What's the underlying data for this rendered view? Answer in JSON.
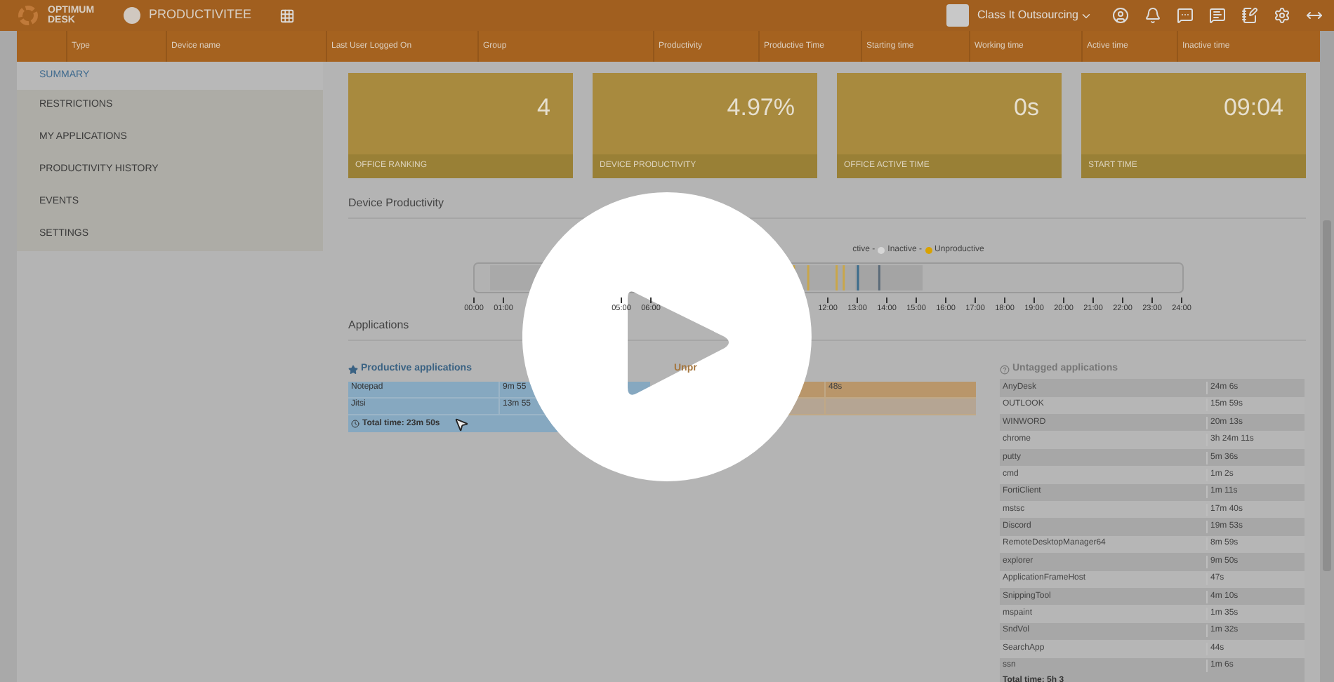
{
  "topbar": {
    "brand": "OPTIMUM DESK",
    "product": "PRODUCTIVITEE",
    "company": "Class It Outsourcing"
  },
  "columns": [
    "Type",
    "Device name",
    "Last User Logged On",
    "Group",
    "Productivity",
    "Productive Time",
    "Starting time",
    "Working time",
    "Active time",
    "Inactive time"
  ],
  "sidebar": {
    "items": [
      {
        "label": "SUMMARY",
        "selected": true
      },
      {
        "label": "RESTRICTIONS",
        "selected": false
      },
      {
        "label": "MY APPLICATIONS",
        "selected": false
      },
      {
        "label": "PRODUCTIVITY HISTORY",
        "selected": false
      },
      {
        "label": "EVENTS",
        "selected": false
      },
      {
        "label": "SETTINGS",
        "selected": false
      }
    ]
  },
  "cards": [
    {
      "value": "4",
      "label": "OFFICE RANKING"
    },
    {
      "value": "4.97%",
      "label": "DEVICE PRODUCTIVITY"
    },
    {
      "value": "0s",
      "label": "OFFICE ACTIVE TIME"
    },
    {
      "value": "09:04",
      "label": "START TIME"
    }
  ],
  "device_productivity": {
    "title": "Device Productivity",
    "legend_cut": "ctive -",
    "legend": [
      {
        "label": "Inactive -",
        "color": "#d6d6d6"
      },
      {
        "label": "Unproductive",
        "color": "#d9a200"
      }
    ],
    "hours_left": [
      "00:00",
      "01:00"
    ],
    "hours_mid": [
      "05:00",
      "06:00"
    ],
    "hours_right": [
      "12:00",
      "13:00",
      "14:00",
      "15:00",
      "16:00",
      "17:00",
      "18:00",
      "19:00",
      "20:00",
      "21:00",
      "22:00",
      "23:00",
      "24:00"
    ]
  },
  "applications": {
    "title": "Applications",
    "productive": {
      "title": "Productive applications",
      "rows": [
        {
          "name": "Notepad",
          "time": "9m 55"
        },
        {
          "name": "Jitsi",
          "time": "13m 55"
        }
      ],
      "total": "Total time: 23m 50s"
    },
    "unproductive": {
      "title": "Unpr",
      "rows": [
        {
          "time": "48s"
        }
      ]
    },
    "untagged": {
      "title": "Untagged applications",
      "rows": [
        {
          "name": "AnyDesk",
          "time": "24m 6s"
        },
        {
          "name": "OUTLOOK",
          "time": "15m 59s"
        },
        {
          "name": "WINWORD",
          "time": "20m 13s"
        },
        {
          "name": "chrome",
          "time": "3h 24m 11s"
        },
        {
          "name": "putty",
          "time": "5m 36s"
        },
        {
          "name": "cmd",
          "time": "1m 2s"
        },
        {
          "name": "FortiClient",
          "time": "1m 11s"
        },
        {
          "name": "mstsc",
          "time": "17m 40s"
        },
        {
          "name": "Discord",
          "time": "19m 53s"
        },
        {
          "name": "RemoteDesktopManager64",
          "time": "8m 59s"
        },
        {
          "name": "explorer",
          "time": "9m 50s"
        },
        {
          "name": "ApplicationFrameHost",
          "time": "47s"
        },
        {
          "name": "SnippingTool",
          "time": "4m 10s"
        },
        {
          "name": "mspaint",
          "time": "1m 35s"
        },
        {
          "name": "SndVol",
          "time": "1m 32s"
        },
        {
          "name": "SearchApp",
          "time": "44s"
        },
        {
          "name": "ssn",
          "time": "1m 6s"
        }
      ],
      "total": "Total time: 5h 3"
    }
  }
}
